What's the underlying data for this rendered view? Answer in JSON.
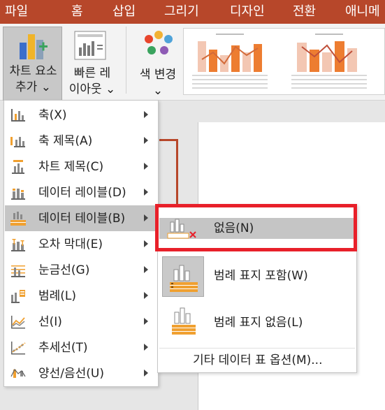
{
  "tabs": [
    "파일",
    "홈",
    "삽입",
    "그리기",
    "디자인",
    "전환",
    "애니메"
  ],
  "ribbon": {
    "add_chart_element": [
      "차트 요소",
      "추가 ⌄"
    ],
    "quick_layout": [
      "빠른 레",
      "이아웃 ⌄"
    ],
    "change_colors": [
      "색 변경",
      "⌄"
    ]
  },
  "menu": {
    "items": [
      {
        "label": "축(X)",
        "has_submenu": true
      },
      {
        "label": "축 제목(A)",
        "has_submenu": true
      },
      {
        "label": "차트 제목(C)",
        "has_submenu": true
      },
      {
        "label": "데이터 레이블(D)",
        "has_submenu": true
      },
      {
        "label": "데이터 테이블(B)",
        "has_submenu": true,
        "selected": true
      },
      {
        "label": "오차 막대(E)",
        "has_submenu": true
      },
      {
        "label": "눈금선(G)",
        "has_submenu": true
      },
      {
        "label": "범례(L)",
        "has_submenu": true
      },
      {
        "label": "선(I)",
        "has_submenu": true
      },
      {
        "label": "추세선(T)",
        "has_submenu": true
      },
      {
        "label": "양선/음선(U)",
        "has_submenu": true
      }
    ]
  },
  "submenu": {
    "none": "없음(N)",
    "with_legend": "범례 표지 포함(W)",
    "no_legend": "범례 표지 없음(L)",
    "more_options": "기타 데이터 표 옵션(M)..."
  },
  "colors": {
    "accent": "#b7472a",
    "highlight": "#e8202a",
    "selected_bg": "#c5c5c5",
    "chart_orange": "#ed7d31"
  }
}
